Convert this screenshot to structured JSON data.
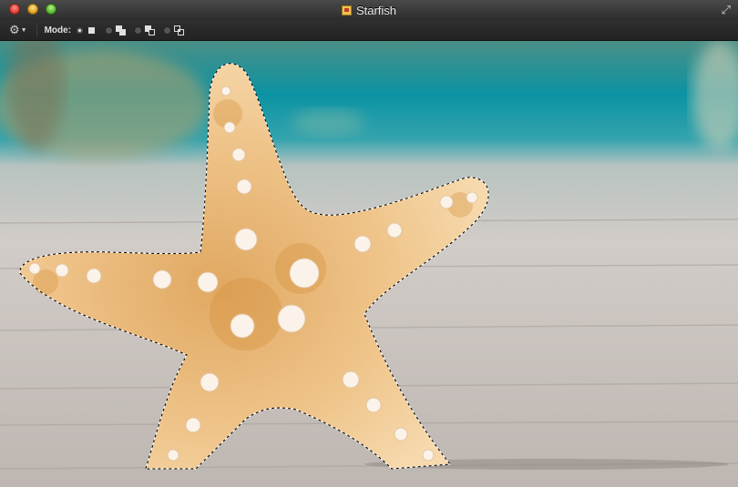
{
  "window": {
    "title": "Starfish",
    "doc_icon": "image-document-icon"
  },
  "toolbar": {
    "actions_icon": "gear-icon",
    "mode_label": "Mode:",
    "modes": [
      {
        "name": "new-selection",
        "selected": true
      },
      {
        "name": "add-to-selection",
        "selected": false
      },
      {
        "name": "subtract-from-selection",
        "selected": false
      },
      {
        "name": "intersect-selection",
        "selected": false
      }
    ]
  },
  "canvas": {
    "content": "starfish-photo",
    "selection": "marching-ants"
  },
  "colors": {
    "sea": "#0a8fa6",
    "boardwalk": "#cfc8c4",
    "starfish": "#e9b777"
  }
}
